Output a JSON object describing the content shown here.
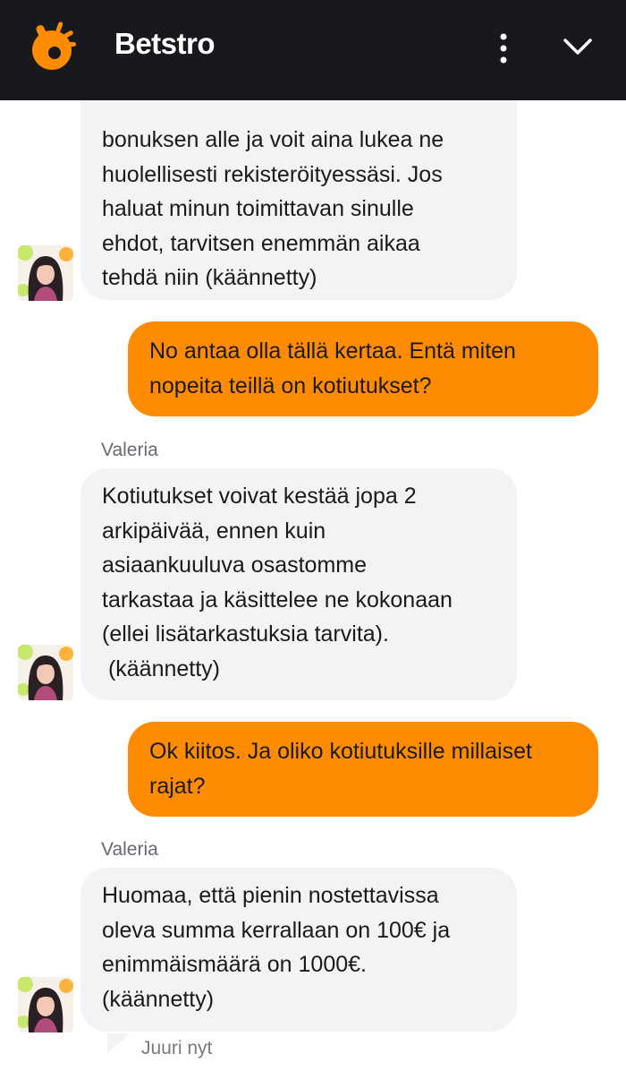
{
  "header": {
    "title": "Betstro",
    "brand_color": "#ff8c00",
    "menu_icon": "more-vertical-icon",
    "collapse_icon": "chevron-down-icon"
  },
  "messages": [
    {
      "role": "agent",
      "lines": [
        "bonuksen alle ja voit aina lukea ne",
        "huolellisesti rekisteröityessäsi. Jos",
        "haluat minun toimittavan sinulle",
        "ehdot, tarvitsen enemmän aikaa",
        "tehdä niin (käännetty)"
      ]
    },
    {
      "role": "user",
      "lines": [
        "No antaa olla tällä kertaa. Entä miten",
        "nopeita teillä on kotiutukset?"
      ]
    },
    {
      "role": "agent",
      "sender": "Valeria",
      "lines": [
        "Kotiutukset voivat kestää jopa 2",
        "arkipäivää, ennen kuin",
        "asiaankuuluva osastomme",
        "tarkastaa ja käsittelee ne kokonaan",
        "(ellei lisätarkastuksia tarvita).",
        " (käännetty)"
      ]
    },
    {
      "role": "user",
      "lines": [
        "Ok kiitos. Ja oliko kotiutuksille millaiset",
        "rajat?"
      ]
    },
    {
      "role": "agent",
      "sender": "Valeria",
      "lines": [
        "Huomaa, että pienin nostettavissa",
        "oleva summa kerrallaan on 100€ ja",
        "enimmäismäärä on 1000€.",
        "(käännetty)"
      ]
    }
  ],
  "status": {
    "time": "Juuri nyt"
  },
  "colors": {
    "header_bg": "#17191c",
    "agent_bubble": "#f2f3f5",
    "user_bubble": "#ff8c00"
  }
}
